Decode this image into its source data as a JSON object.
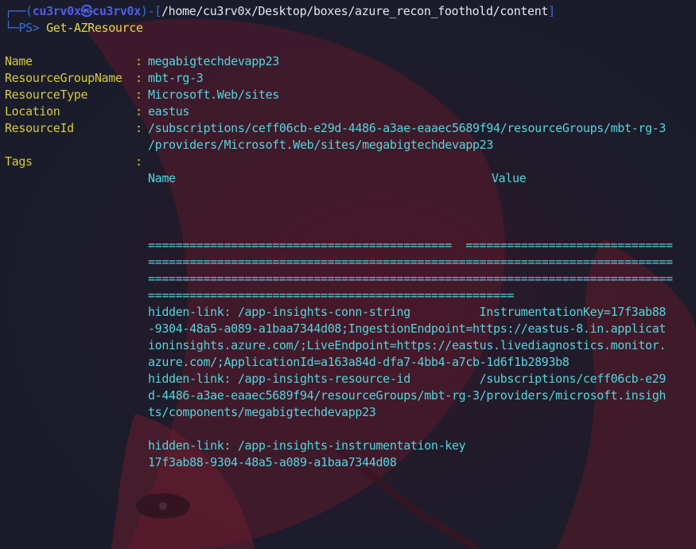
{
  "prompt": {
    "frame_top": "┌──(",
    "user": "cu3rv0x",
    "at_symbol": "㉿",
    "host": "cu3rv0x",
    "frame_mid": ")-[",
    "path": "/home/cu3rv0x/Desktop/boxes/azure_recon_foothold/content",
    "frame_close": "]",
    "frame_bottom": "└─",
    "ps_label": "PS> ",
    "command": "Get-AZResource"
  },
  "resource": {
    "name_key": "Name",
    "name_value": "megabigtechdevapp23",
    "rg_key": "ResourceGroupName",
    "rg_value": "mbt-rg-3",
    "type_key": "ResourceType",
    "type_value": "Microsoft.Web/sites",
    "location_key": "Location",
    "location_value": "eastus",
    "id_key": "ResourceId",
    "id_value_line1": "/subscriptions/ceff06cb-e29d-4486-a3ae-eaaec5689f94/resourceGroups/mbt-rg-3",
    "id_value_line2": "/providers/Microsoft.Web/sites/megabigtechdevapp23",
    "tags_key": "Tags",
    "separator": ":"
  },
  "tags_table": {
    "header_name": "Name",
    "header_value": "Value",
    "rule_line1": "============================================  ==============================",
    "rule_line2": "============================================================================",
    "rule_line3": "============================================================================",
    "rule_line4": "=====================================================",
    "rows": [
      "hidden-link: /app-insights-conn-string          InstrumentationKey=17f3ab88",
      "-9304-48a5-a089-a1baa7344d08;IngestionEndpoint=https://eastus-8.in.applicat",
      "ioninsights.azure.com/;LiveEndpoint=https://eastus.livediagnostics.monitor.",
      "azure.com/;ApplicationId=a163a84d-dfa7-4bb4-a7cb-1d6f1b2893b8",
      "hidden-link: /app-insights-resource-id          /subscriptions/ceff06cb-e29",
      "d-4486-a3ae-eaaec5689f94/resourceGroups/mbt-rg-3/providers/microsoft.insigh",
      "ts/components/megabigtechdevapp23",
      "",
      "hidden-link: /app-insights-instrumentation-key",
      "17f3ab88-9304-48a5-a089-a1baa7344d08"
    ]
  },
  "colors": {
    "background": "#1b1c2b",
    "accent_blue": "#3a6fd8",
    "key_yellow": "#d6c940",
    "value_cyan": "#52d6dc",
    "wallpaper_red": "#7a1426"
  }
}
